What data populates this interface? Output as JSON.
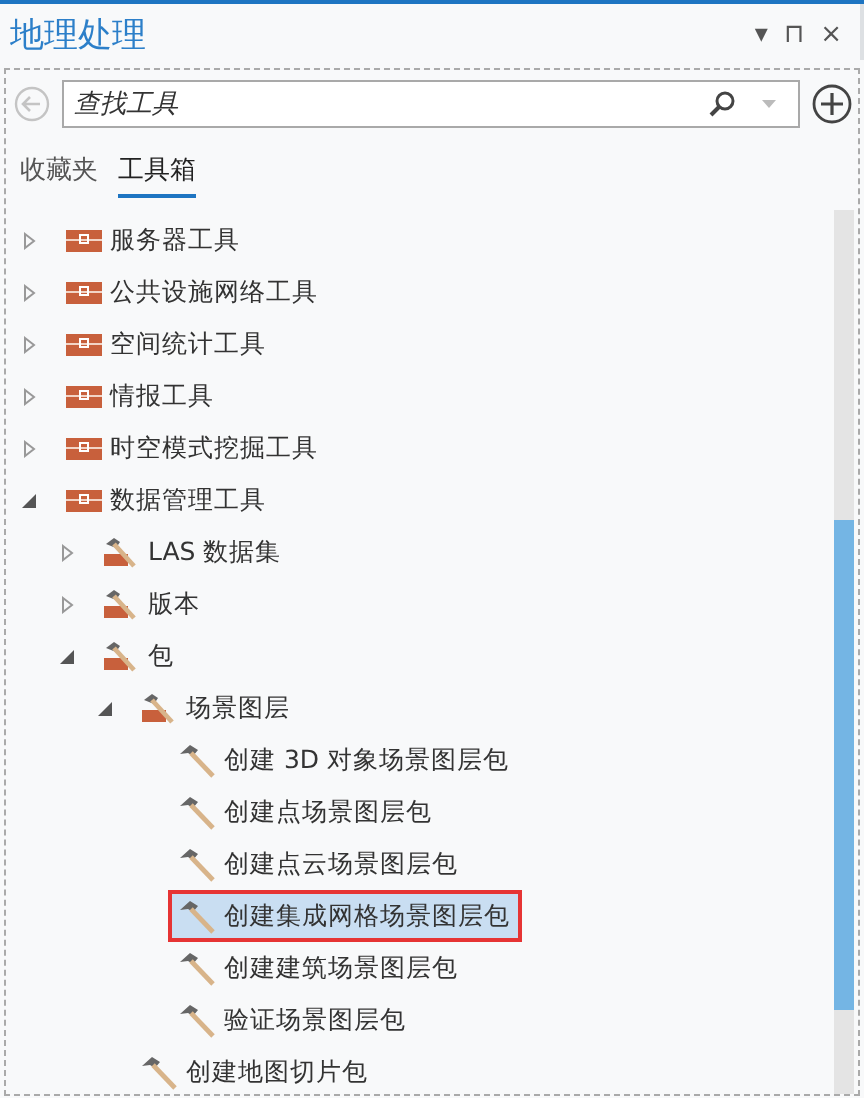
{
  "panel": {
    "title": "地理处理",
    "controls": [
      "▾",
      "⊓",
      "×"
    ]
  },
  "search": {
    "placeholder": "查找工具"
  },
  "tabs": [
    {
      "label": "收藏夹",
      "selected": false
    },
    {
      "label": "工具箱",
      "selected": true
    }
  ],
  "tree": [
    {
      "label": "服务器工具",
      "kind": "toolbox",
      "expanded": false
    },
    {
      "label": "公共设施网络工具",
      "kind": "toolbox",
      "expanded": false
    },
    {
      "label": "空间统计工具",
      "kind": "toolbox",
      "expanded": false
    },
    {
      "label": "情报工具",
      "kind": "toolbox",
      "expanded": false
    },
    {
      "label": "时空模式挖掘工具",
      "kind": "toolbox",
      "expanded": false
    },
    {
      "label": "数据管理工具",
      "kind": "toolbox",
      "expanded": true,
      "children": [
        {
          "label": "LAS 数据集",
          "kind": "toolset",
          "expanded": false
        },
        {
          "label": "版本",
          "kind": "toolset",
          "expanded": false
        },
        {
          "label": "包",
          "kind": "toolset",
          "expanded": true,
          "children": [
            {
              "label": "场景图层",
              "kind": "toolset",
              "expanded": true,
              "children": [
                {
                  "label": "创建 3D 对象场景图层包",
                  "kind": "tool",
                  "selected": false
                },
                {
                  "label": "创建点场景图层包",
                  "kind": "tool",
                  "selected": false
                },
                {
                  "label": "创建点云场景图层包",
                  "kind": "tool",
                  "selected": false
                },
                {
                  "label": "创建集成网格场景图层包",
                  "kind": "tool",
                  "selected": true
                },
                {
                  "label": "创建建筑场景图层包",
                  "kind": "tool",
                  "selected": false
                },
                {
                  "label": "验证场景图层包",
                  "kind": "tool",
                  "selected": false
                }
              ]
            },
            {
              "label": "创建地图切片包",
              "kind": "tool",
              "selected": false
            }
          ]
        }
      ]
    }
  ]
}
